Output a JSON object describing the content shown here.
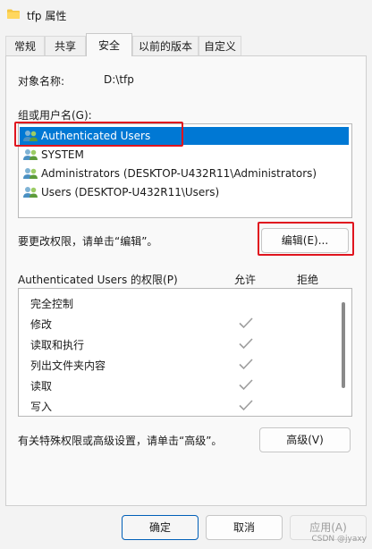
{
  "window": {
    "title": "tfp 属性",
    "folder_icon": "folder-icon"
  },
  "tabs": [
    {
      "label": "常规",
      "active": false
    },
    {
      "label": "共享",
      "active": false
    },
    {
      "label": "安全",
      "active": true
    },
    {
      "label": "以前的版本",
      "active": false
    },
    {
      "label": "自定义",
      "active": false
    }
  ],
  "security": {
    "object_name_label": "对象名称:",
    "object_name_value": "D:\\tfp",
    "group_label": "组或用户名(G):",
    "groups": [
      {
        "label": "Authenticated Users",
        "icon": "users-icon",
        "selected": true
      },
      {
        "label": "SYSTEM",
        "icon": "users-icon",
        "selected": false
      },
      {
        "label": "Administrators (DESKTOP-U432R11\\Administrators)",
        "icon": "users-icon",
        "selected": false
      },
      {
        "label": "Users (DESKTOP-U432R11\\Users)",
        "icon": "users-icon",
        "selected": false
      }
    ],
    "edit_hint": "要更改权限，请单击“编辑”。",
    "edit_button": "编辑(E)...",
    "permissions_header": "Authenticated Users 的权限(P)",
    "allow_header": "允许",
    "deny_header": "拒绝",
    "permissions": [
      {
        "name": "完全控制",
        "allow": false
      },
      {
        "name": "修改",
        "allow": true
      },
      {
        "name": "读取和执行",
        "allow": true
      },
      {
        "name": "列出文件夹内容",
        "allow": true
      },
      {
        "name": "读取",
        "allow": true
      },
      {
        "name": "写入",
        "allow": true
      }
    ],
    "advanced_hint": "有关特殊权限或高级设置，请单击“高级”。",
    "advanced_button": "高级(V)"
  },
  "footer": {
    "ok": "确定",
    "cancel": "取消",
    "apply": "应用(A)"
  },
  "watermark": "CSDN @jyaxy",
  "colors": {
    "accent": "#0078d4",
    "highlight": "#e0141e",
    "check": "#9e9e9e"
  }
}
